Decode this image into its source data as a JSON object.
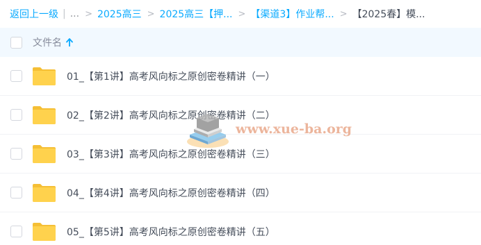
{
  "breadcrumb": {
    "back_label": "返回上一级",
    "ellipsis": "...",
    "items": [
      "2025高三",
      "2025高三【押...",
      "【渠道3】作业帮...",
      "【2025春】模..."
    ]
  },
  "list_header": {
    "title": "文件名",
    "sort": "ascending-arrow-icon"
  },
  "rows": [
    {
      "name": "01_【第1讲】高考风向标之原创密卷精讲（一）"
    },
    {
      "name": "02_【第2讲】高考风向标之原创密卷精讲（二）"
    },
    {
      "name": "03_【第3讲】高考风向标之原创密卷精讲（三）"
    },
    {
      "name": "04_【第4讲】高考风向标之原创密卷精讲（四）"
    },
    {
      "name": "05_【第5讲】高考风向标之原创密卷精讲（五）"
    }
  ],
  "watermark": {
    "text": "www.xue-ba.org"
  },
  "colors": {
    "accent": "#09aaff",
    "header_bg": "#f2f9ff",
    "folder": "#ffd24d",
    "text": "#454d5a"
  }
}
